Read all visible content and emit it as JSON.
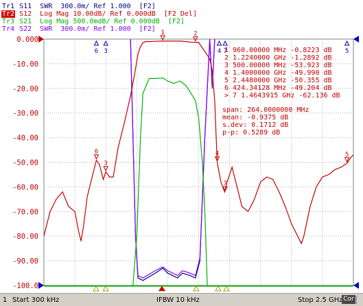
{
  "traces": [
    {
      "id": "Tr1",
      "text": " S11  SWR  300.0m/ Ref 1.000  [F2]",
      "color": "#000080",
      "active": false
    },
    {
      "id": "Tr2",
      "text": " S12  Log Mag 10.00dB/ Ref 0.000dB  [F2 Del]",
      "color": "#c00000",
      "active": true
    },
    {
      "id": "Tr3",
      "text": " S21  Log Mag 500.0mdB/ Ref 0.000dB  [F2]",
      "color": "#00b000",
      "active": false
    },
    {
      "id": "Tr4",
      "text": " S22  SWR  300.0m/ Ref 1.000  [F2]",
      "color": "#8000ff",
      "active": false
    }
  ],
  "y_ticks": [
    "0.000",
    "-10.00",
    "-20.00",
    "-30.00",
    "-40.00",
    "-50.00",
    "-60.00",
    "-70.00",
    "-80.00",
    "-90.00",
    "-100.0"
  ],
  "markers": [
    {
      "n": "1",
      "freq": "960.00000 MHz",
      "value": "-0.8223 dB"
    },
    {
      "n": "2",
      "freq": "1.2240000 GHz",
      "value": "-1.2892 dB"
    },
    {
      "n": "3",
      "freq": "500.00000 MHz",
      "value": "-53.923 dB"
    },
    {
      "n": "4",
      "freq": "1.4000000 GHz",
      "value": "-49.990 dB"
    },
    {
      "n": "5",
      "freq": "2.4480000 GHz",
      "value": "-50.355 dB"
    },
    {
      "n": "6",
      "freq": "424.34128 MHz",
      "value": "-49.204 dB"
    },
    {
      "n": "7",
      "freq": "1.4643915 GHz",
      "value": "-62.136 dB"
    }
  ],
  "stats": [
    {
      "label": "span:",
      "value": "264.0000000 MHz"
    },
    {
      "label": "mean:",
      "value": "-0.9375 dB"
    },
    {
      "label": "s.dev:",
      "value": "0.1712 dB"
    },
    {
      "label": "p-p:",
      "value": "0.5289 dB"
    }
  ],
  "status": {
    "channel": "1",
    "start": "Start 300 kHz",
    "ifbw": "IFBW 10 kHz",
    "stop": "Stop 2.5 GHz",
    "cor": "Cor"
  },
  "chart_data": {
    "type": "line",
    "xlabel": "",
    "ylabel": "",
    "x_range_hz": [
      300000,
      2500000000
    ],
    "ylim": [
      -100,
      0
    ],
    "grid": true,
    "series": [
      {
        "name": "S12",
        "color": "#c00000",
        "x_ghz": [
          0.0,
          0.05,
          0.1,
          0.15,
          0.2,
          0.25,
          0.28,
          0.3,
          0.32,
          0.35,
          0.4,
          0.424,
          0.45,
          0.48,
          0.5,
          0.53,
          0.56,
          0.6,
          0.65,
          0.7,
          0.73,
          0.75,
          0.76,
          0.78,
          0.8,
          0.82,
          0.85,
          0.9,
          0.96,
          1.05,
          1.1,
          1.15,
          1.2,
          1.224,
          1.25,
          1.3,
          1.34,
          1.36,
          1.38,
          1.4,
          1.43,
          1.46,
          1.48,
          1.52,
          1.56,
          1.6,
          1.65,
          1.7,
          1.75,
          1.8,
          1.85,
          1.9,
          1.95,
          2.0,
          2.05,
          2.08,
          2.1,
          2.15,
          2.2,
          2.25,
          2.3,
          2.35,
          2.4,
          2.448,
          2.48,
          2.5
        ],
        "y_db": [
          -80,
          -70,
          -65,
          -62,
          -68,
          -70,
          -78,
          -82,
          -76,
          -64,
          -54,
          -49.2,
          -51,
          -57,
          -53.9,
          -56,
          -56,
          -44,
          -34,
          -23,
          -15,
          -9,
          -6,
          -3,
          -1.5,
          -1,
          -1,
          -0.9,
          -0.8,
          -0.8,
          -0.8,
          -1,
          -1.3,
          -1.29,
          -1.4,
          -5,
          -8,
          -13,
          -25,
          -49.99,
          -58,
          -62.1,
          -58,
          -52,
          -60,
          -68,
          -70,
          -65,
          -58,
          -56,
          -57,
          -62,
          -68,
          -75,
          -80,
          -83,
          -80,
          -68,
          -60,
          -56,
          -55,
          -53,
          -52,
          -50.4,
          -48,
          -47
        ]
      },
      {
        "name": "S21",
        "color": "#00b000",
        "x_ghz": [
          0.72,
          0.75,
          0.78,
          0.8,
          0.85,
          0.9,
          0.96,
          1.0,
          1.05,
          1.1,
          1.15,
          1.2,
          1.224,
          1.25,
          1.28,
          1.3,
          1.32
        ],
        "y_db": [
          -100,
          -80,
          -40,
          -22,
          -16,
          -16,
          -15.8,
          -17,
          -18,
          -17,
          -19,
          -23,
          -25,
          -32,
          -50,
          -70,
          -100
        ]
      },
      {
        "name": "S11",
        "color": "#000080",
        "x_ghz": [
          0.7,
          0.72,
          0.74,
          0.76,
          0.8,
          0.9,
          0.96,
          1.0,
          1.08,
          1.12,
          1.18,
          1.224,
          1.26,
          1.3,
          1.34,
          1.36,
          1.38
        ],
        "y_db": [
          0,
          -40,
          -80,
          -97,
          -98,
          -95,
          -93,
          -95,
          -97,
          -95,
          -96,
          -97,
          -90,
          -40,
          0,
          -20,
          0
        ]
      },
      {
        "name": "S22",
        "color": "#8000ff",
        "x_ghz": [
          0.7,
          0.72,
          0.74,
          0.76,
          0.8,
          0.9,
          0.96,
          1.0,
          1.08,
          1.12,
          1.18,
          1.224,
          1.26,
          1.3,
          1.34,
          1.36,
          1.38
        ],
        "y_db": [
          0,
          -40,
          -80,
          -96,
          -97,
          -94,
          -92.5,
          -94,
          -96,
          -94,
          -95,
          -96,
          -89,
          -40,
          0,
          -20,
          0
        ]
      }
    ],
    "marker_positions": [
      {
        "n": "1",
        "x_ghz": 0.96,
        "y_db": -0.8223
      },
      {
        "n": "2",
        "x_ghz": 1.224,
        "y_db": -1.2892
      },
      {
        "n": "3",
        "x_ghz": 0.5,
        "y_db": -53.923
      },
      {
        "n": "4",
        "x_ghz": 1.4,
        "y_db": -49.99
      },
      {
        "n": "5",
        "x_ghz": 2.448,
        "y_db": -50.355
      },
      {
        "n": "6",
        "x_ghz": 0.424,
        "y_db": -49.204
      },
      {
        "n": "7",
        "x_ghz": 1.4644,
        "y_db": -62.136
      }
    ]
  }
}
